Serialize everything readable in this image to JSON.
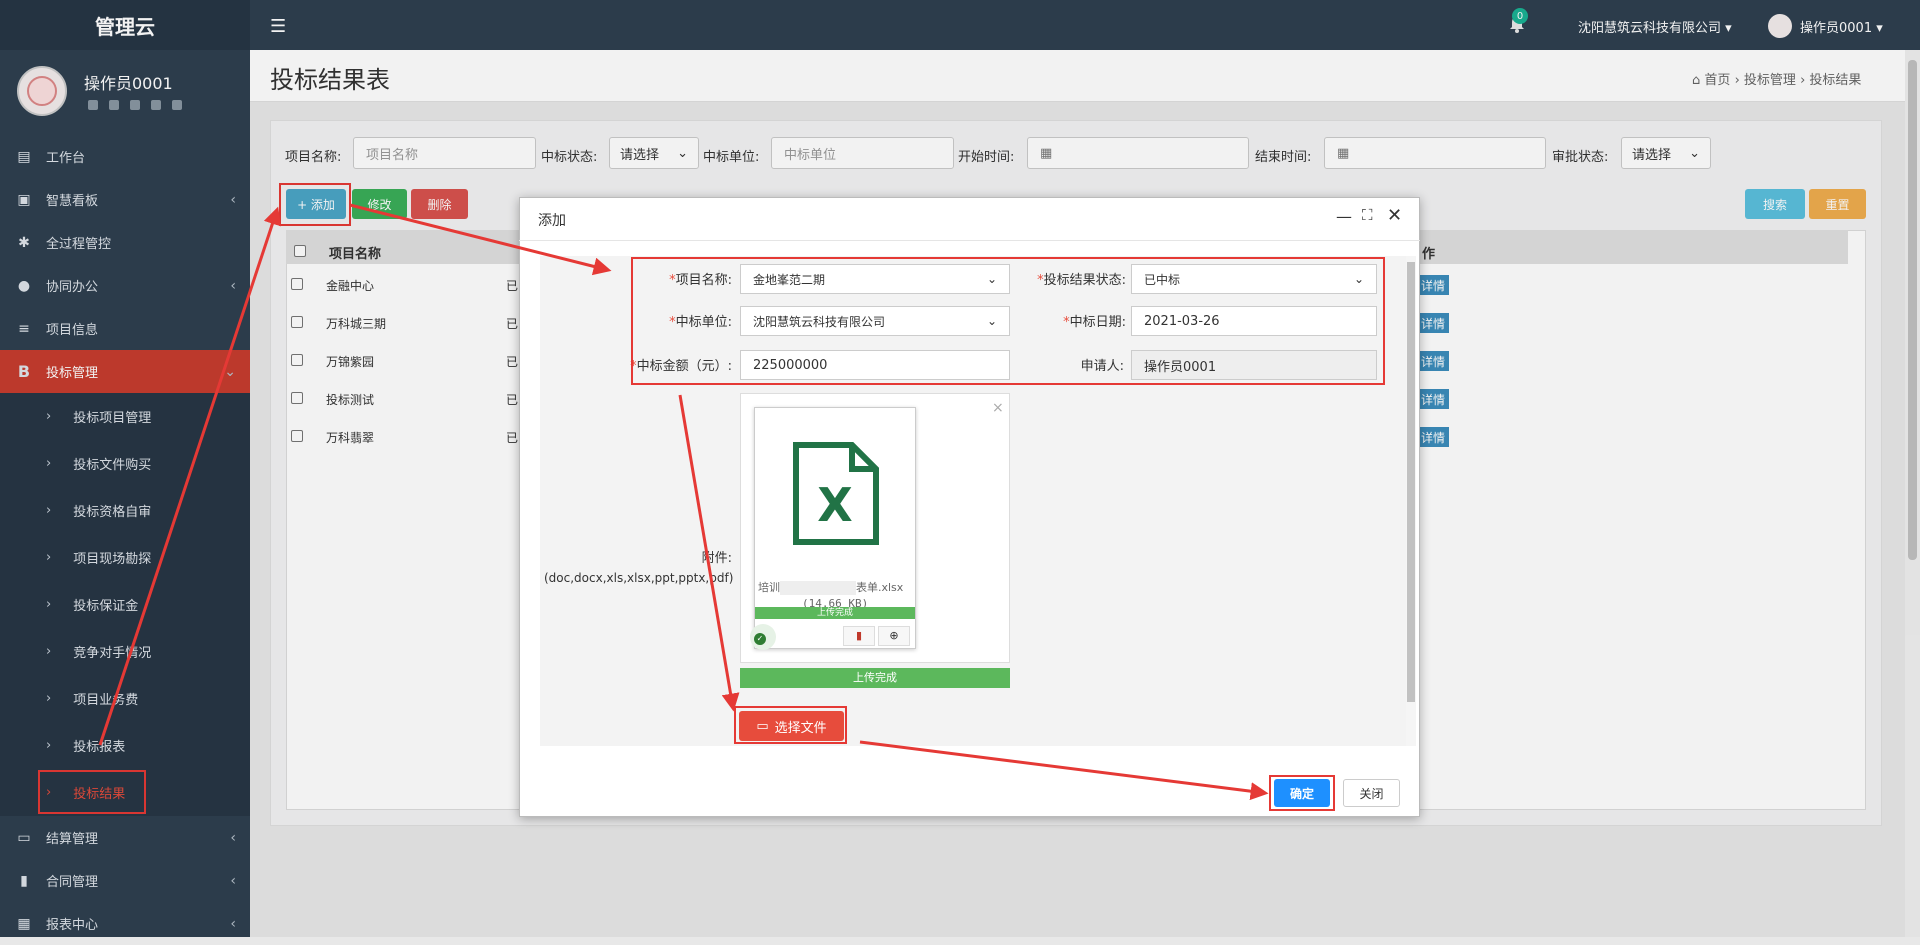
{
  "app": {
    "title": "管理云"
  },
  "user": {
    "name": "操作员0001"
  },
  "topbar": {
    "notif_count": "0",
    "company": "沈阳慧筑云科技有限公司 ▾",
    "user": "操作员0001 ▾"
  },
  "sidebar": {
    "items": [
      {
        "label": "工作台",
        "icon": "desktop-icon"
      },
      {
        "label": "智慧看板",
        "icon": "dashboard-icon"
      },
      {
        "label": "全过程管控",
        "icon": "asterisk-icon"
      },
      {
        "label": "协同办公",
        "icon": "users-icon"
      },
      {
        "label": "项目信息",
        "icon": "list-icon"
      },
      {
        "label": "投标管理",
        "icon": "b-icon"
      },
      {
        "label": "结算管理",
        "icon": "monitor-icon"
      },
      {
        "label": "合同管理",
        "icon": "file-icon"
      },
      {
        "label": "报表中心",
        "icon": "table-icon"
      }
    ],
    "sub": [
      "投标项目管理",
      "投标文件购买",
      "投标资格自审",
      "项目现场勘探",
      "投标保证金",
      "竞争对手情况",
      "项目业务费",
      "投标报表",
      "投标结果"
    ]
  },
  "page": {
    "title": "投标结果表",
    "breadcrumb": [
      "首页",
      "投标管理",
      "投标结果"
    ]
  },
  "filters": {
    "project_label": "项目名称:",
    "project_placeholder": "项目名称",
    "status_label": "中标状态:",
    "status_value": "请选择",
    "unit_label": "中标单位:",
    "unit_placeholder": "中标单位",
    "start_label": "开始时间:",
    "end_label": "结束时间:",
    "approval_label": "审批状态:",
    "approval_value": "请选择"
  },
  "toolbar": {
    "add": "+ 添加",
    "edit": "修改",
    "delete": "删除",
    "search": "搜索",
    "reset": "重置"
  },
  "table": {
    "headers": [
      "项目名称",
      "作"
    ],
    "rows": [
      {
        "name": "金融中心",
        "status": "已",
        "action": "详情"
      },
      {
        "name": "万科城三期",
        "status": "已",
        "action": "详情"
      },
      {
        "name": "万锦紫园",
        "status": "已",
        "action": "详情"
      },
      {
        "name": "投标测试",
        "status": "已",
        "action": "详情"
      },
      {
        "name": "万科翡翠",
        "status": "已",
        "action": "详情"
      }
    ]
  },
  "dialog": {
    "title": "添加",
    "project_label": "项目名称:",
    "project_value": "金地峯范二期",
    "result_label": "投标结果状态:",
    "result_value": "已中标",
    "unit_label": "中标单位:",
    "unit_value": "沈阳慧筑云科技有限公司",
    "date_label": "中标日期:",
    "date_value": "2021-03-26",
    "amount_label": "中标金额（元）:",
    "amount_value": "225000000",
    "applicant_label": "申请人:",
    "applicant_value": "操作员0001",
    "attach_label": "附件:",
    "attach_types": "(doc,docx,xls,xlsx,ppt,pptx,pdf)",
    "file_name_prefix": "培训",
    "file_name_suffix": "表单.xlsx",
    "file_size": "(14.66 KB)",
    "file_progress_text": "上传完成",
    "upload_done": "上传完成",
    "choose_file": "选择文件",
    "confirm": "确定",
    "close": "关闭"
  }
}
